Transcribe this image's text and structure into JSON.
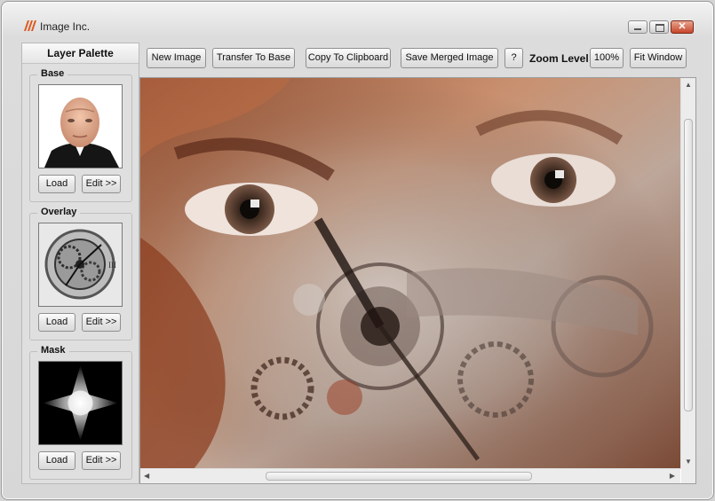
{
  "window": {
    "title": "Image Inc.",
    "minimize_icon": "minimize-icon",
    "maximize_icon": "maximize-icon",
    "close_icon": "close-icon",
    "close_glyph": "✕"
  },
  "palette": {
    "header": "Layer Palette",
    "groups": [
      {
        "label": "Base",
        "load_label": "Load",
        "edit_label": "Edit >>",
        "thumbnail": "portrait-photo"
      },
      {
        "label": "Overlay",
        "load_label": "Load",
        "edit_label": "Edit >>",
        "thumbnail": "clockwork-photo"
      },
      {
        "label": "Mask",
        "load_label": "Load",
        "edit_label": "Edit >>",
        "thumbnail": "radial-star-mask"
      }
    ]
  },
  "toolbar": {
    "new_image": "New Image",
    "transfer_to_base": "Transfer To Base",
    "copy_to_clipboard": "Copy To Clipboard",
    "save_merged_image": "Save Merged Image",
    "help": "?",
    "zoom_label": "Zoom Level",
    "zoom_value": "100%",
    "fit_window": "Fit Window"
  },
  "canvas": {
    "image": "merged-face-clockwork-image",
    "scroll_up": "▲",
    "scroll_down": "▼",
    "scroll_left": "◀",
    "scroll_right": "▶"
  },
  "colors": {
    "accent": "#e0561c",
    "window_bg": "#d7d7d7",
    "close_button": "#c6452a"
  }
}
